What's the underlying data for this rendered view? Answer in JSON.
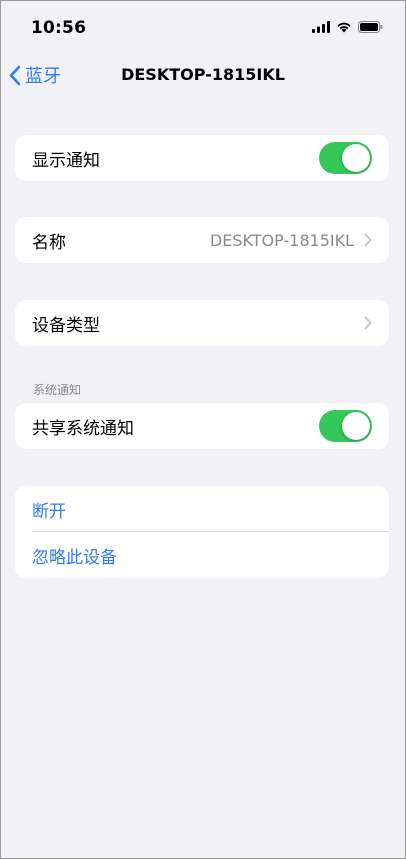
{
  "status_bar": {
    "time": "10:56",
    "icons": [
      "cellular-signal-icon",
      "wifi-icon",
      "battery-icon"
    ]
  },
  "nav": {
    "back_label": "蓝牙",
    "title": "DESKTOP-1815IKL"
  },
  "rows": {
    "show_notifications": {
      "label": "显示通知",
      "toggle_on": true
    },
    "name": {
      "label": "名称",
      "value": "DESKTOP-1815IKL"
    },
    "device_type": {
      "label": "设备类型"
    },
    "share_system_notifications": {
      "label": "共享系统通知",
      "toggle_on": true
    },
    "disconnect": {
      "label": "断开"
    },
    "forget_device": {
      "label": "忽略此设备"
    }
  },
  "section": {
    "system_notifications_header": "系统通知"
  },
  "colors": {
    "accent": "#2f7cf6",
    "toggle_on": "#34c759",
    "background": "#f1f1f6"
  }
}
